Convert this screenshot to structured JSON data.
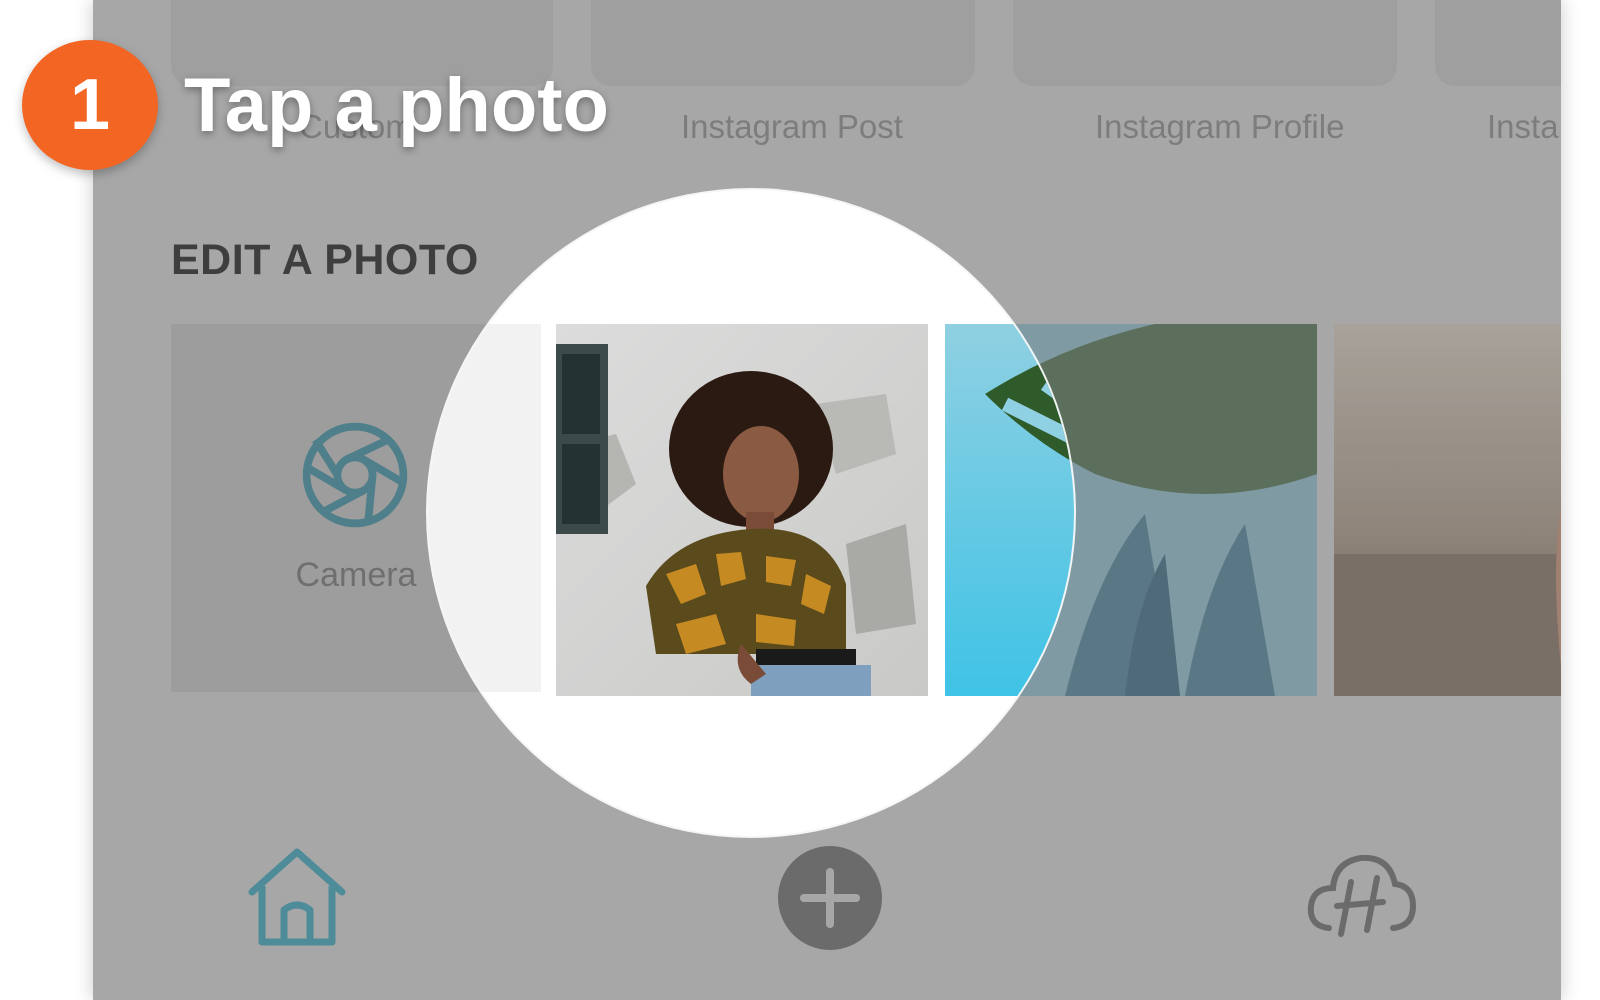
{
  "step": {
    "number": "1",
    "instruction": "Tap a photo",
    "badge_color": "#f26522"
  },
  "templates": [
    {
      "label": "Custom"
    },
    {
      "label": "Instagram Post"
    },
    {
      "label": "Instagram Profile"
    },
    {
      "label": "Insta"
    }
  ],
  "edit_section": {
    "title": "EDIT A PHOTO",
    "camera_label": "Camera",
    "camera_icon": "camera-shutter-icon",
    "photos": [
      {
        "name": "woman-portrait-photo"
      },
      {
        "name": "monstera-leaf-photo"
      },
      {
        "name": "beach-sunset-photo"
      }
    ]
  },
  "nav": {
    "home_icon": "home-icon",
    "add_icon": "plus-icon",
    "cloud_icon": "cloud-h-icon"
  },
  "colors": {
    "accent_teal": "#4f8c99",
    "overlay_gray": "#a7a7a7"
  }
}
